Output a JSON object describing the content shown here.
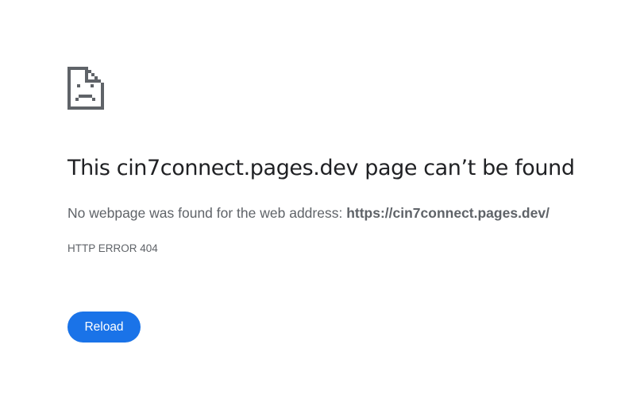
{
  "icon": {
    "name": "sad-file-icon",
    "color": "#5f6368"
  },
  "heading": {
    "title": "This cin7connect.pages.dev page can’t be found"
  },
  "message": {
    "prefix": "No webpage was found for the web address: ",
    "url": "https://cin7connect.pages.dev/"
  },
  "error": {
    "code": "HTTP ERROR 404"
  },
  "actions": {
    "reload_label": "Reload",
    "button_color": "#1a73e8"
  }
}
